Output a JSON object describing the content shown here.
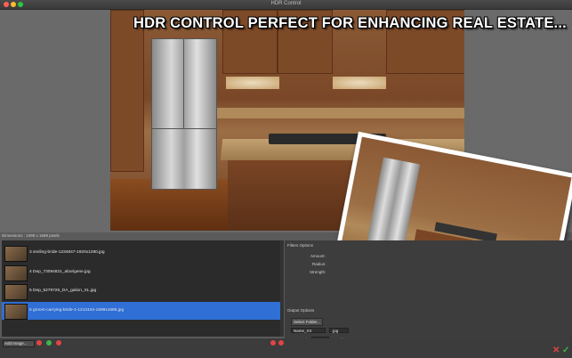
{
  "window": {
    "title": "HDR Control"
  },
  "banner": {
    "text": "HDR CONTROL PERFECT FOR ENHANCING REAL ESTATE..."
  },
  "dimensions": {
    "text": "Dimensions : 1099 x 1669 pixels"
  },
  "file_list": {
    "items": [
      {
        "label": "3 smiling-bride-1234847-1920x1280.jpg",
        "selected": false
      },
      {
        "label": "4 Dep_73094821_aborigene.jpg",
        "selected": false
      },
      {
        "label": "5 Dep_5279726_DA_galion_XL.jpg",
        "selected": false
      },
      {
        "label": "6 groom-carrying-bride-1-1214104-1599x1686.jpg",
        "selected": true
      }
    ]
  },
  "toolbar": {
    "add_image_label": "Add Image..."
  },
  "filters": {
    "title": "Filters Options",
    "amount_label": "Amount:",
    "radius_label": "Radius:",
    "strength_label": "Strength:"
  },
  "output": {
    "title": "Output Options",
    "select_folder_label": "Select Folder...",
    "name_select": "Name_XX",
    "format_select": ".jpg",
    "xx_starting_label": "XX starting:",
    "xx_starting_value": "0",
    "quality_label": "Quality:",
    "quality_value": "100"
  },
  "colors": {
    "selection": "#2f6fd6",
    "cancel": "#e04545",
    "confirm": "#3fb44a"
  },
  "icons": {
    "cancel": "x-icon",
    "confirm": "checkmark-icon"
  }
}
